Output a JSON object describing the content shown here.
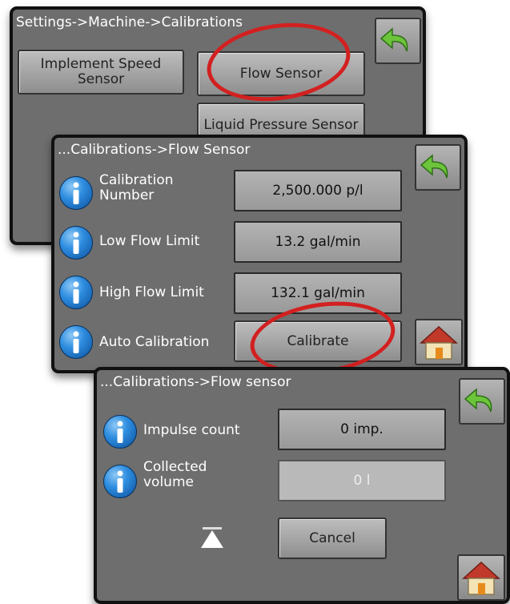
{
  "panel1": {
    "breadcrumb": "Settings->Machine->Calibrations",
    "implement_speed_label": "Implement Speed Sensor",
    "flow_sensor_label": "Flow Sensor",
    "liquid_pressure_label": "Liquid Pressure Sensor"
  },
  "panel2": {
    "breadcrumb": "...Calibrations->Flow Sensor",
    "rows": [
      {
        "label": "Calibration Number",
        "value": "2,500.000 p/l"
      },
      {
        "label": "Low Flow Limit",
        "value": "13.2 gal/min"
      },
      {
        "label": "High Flow Limit",
        "value": "132.1 gal/min"
      },
      {
        "label": "Auto Calibration",
        "value": "Calibrate"
      }
    ]
  },
  "panel3": {
    "breadcrumb": "...Calibrations->Flow sensor",
    "rows": [
      {
        "label": "Impulse count",
        "value": "0 imp."
      },
      {
        "label": "Collected volume",
        "value": "0 l"
      }
    ],
    "cancel_label": "Cancel"
  },
  "icons": {
    "back": "back-arrow-icon",
    "home": "home-icon",
    "info": "info-icon",
    "eject": "eject-icon"
  },
  "colors": {
    "panel_bg": "#6e6e6e",
    "highlight": "#d32020",
    "back_arrow": "#6cc43a",
    "info_blue": "#2f8ee0"
  }
}
